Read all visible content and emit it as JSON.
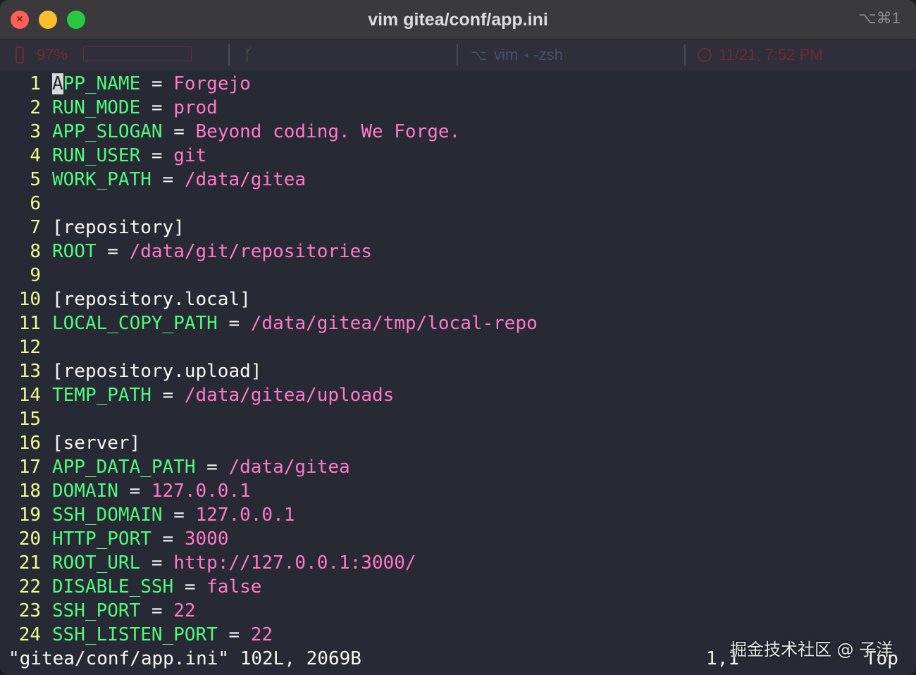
{
  "window": {
    "title": "vim gitea/conf/app.ini",
    "shortcut": "⌥⌘1"
  },
  "statusbar": {
    "battery": "97%",
    "process": "vim",
    "shell": "-zsh",
    "datetime": "11/21, 7:52 PM"
  },
  "lines": [
    {
      "n": "1",
      "key": "APP_NAME",
      "val": "Forgejo"
    },
    {
      "n": "2",
      "key": "RUN_MODE",
      "val": "prod"
    },
    {
      "n": "3",
      "key": "APP_SLOGAN",
      "val": "Beyond coding. We Forge."
    },
    {
      "n": "4",
      "key": "RUN_USER",
      "val": "git"
    },
    {
      "n": "5",
      "key": "WORK_PATH",
      "val": "/data/gitea"
    },
    {
      "n": "6"
    },
    {
      "n": "7",
      "section": "[repository]"
    },
    {
      "n": "8",
      "key": "ROOT",
      "val": "/data/git/repositories"
    },
    {
      "n": "9"
    },
    {
      "n": "10",
      "section": "[repository.local]"
    },
    {
      "n": "11",
      "key": "LOCAL_COPY_PATH",
      "val": "/data/gitea/tmp/local-repo"
    },
    {
      "n": "12"
    },
    {
      "n": "13",
      "section": "[repository.upload]"
    },
    {
      "n": "14",
      "key": "TEMP_PATH",
      "val": "/data/gitea/uploads"
    },
    {
      "n": "15"
    },
    {
      "n": "16",
      "section": "[server]"
    },
    {
      "n": "17",
      "key": "APP_DATA_PATH",
      "val": "/data/gitea"
    },
    {
      "n": "18",
      "key": "DOMAIN",
      "val": "127.0.0.1"
    },
    {
      "n": "19",
      "key": "SSH_DOMAIN",
      "val": "127.0.0.1"
    },
    {
      "n": "20",
      "key": "HTTP_PORT",
      "val": "3000"
    },
    {
      "n": "21",
      "key": "ROOT_URL",
      "val": "http://127.0.0.1:3000/"
    },
    {
      "n": "22",
      "key": "DISABLE_SSH",
      "val": "false"
    },
    {
      "n": "23",
      "key": "SSH_PORT",
      "val": "22"
    },
    {
      "n": "24",
      "key": "SSH_LISTEN_PORT",
      "val": "22"
    }
  ],
  "cmdline": "\"gitea/conf/app.ini\" 102L, 2069B",
  "cursor_pos": "1,1",
  "scroll_pos": "Top",
  "watermark": "掘金技术社区 @ 子洋",
  "colors": {
    "background": "#272935",
    "line_number": "#f1fa8c",
    "key": "#50fa7b",
    "value": "#ff79c6",
    "text": "#f8f8f2"
  }
}
